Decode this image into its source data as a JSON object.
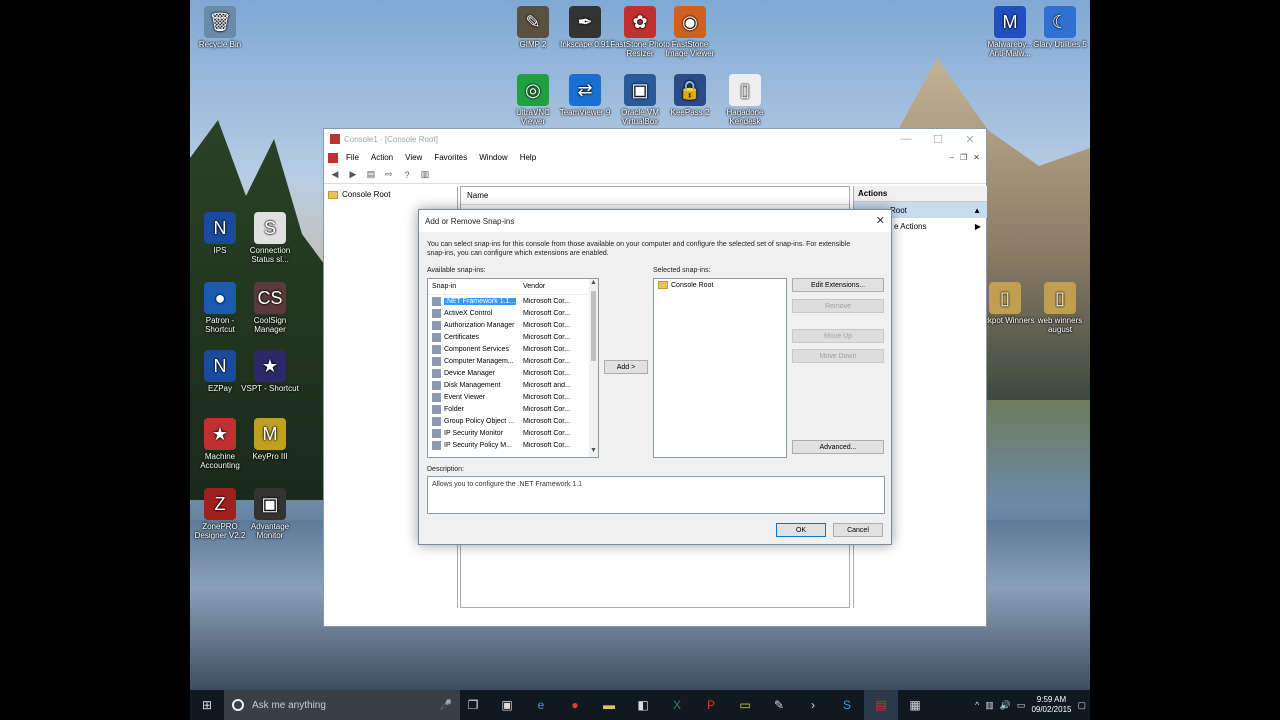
{
  "desktop": {
    "icons": [
      {
        "label": "Recycle Bin",
        "glyph": "🗑",
        "color": "#6a8aa8"
      },
      {
        "label": "GIMP 2",
        "glyph": "✎",
        "color": "#5a5040"
      },
      {
        "label": "Inkscape 0.91",
        "glyph": "✒",
        "color": "#333"
      },
      {
        "label": "FastStone Photo Resizer",
        "glyph": "✿",
        "color": "#c03030"
      },
      {
        "label": "FastStone Image Viewer",
        "glyph": "◉",
        "color": "#d06020"
      },
      {
        "label": "Malwareby... Anti-Malw...",
        "glyph": "M",
        "color": "#2050c0"
      },
      {
        "label": "Glary Utilities 5",
        "glyph": "☾",
        "color": "#3070d0"
      },
      {
        "label": "UltraVNC Viewer",
        "glyph": "◎",
        "color": "#20a040"
      },
      {
        "label": "TeamViewer 9",
        "glyph": "⇄",
        "color": "#1a70d0"
      },
      {
        "label": "Oracle VM VirtualBox",
        "glyph": "▣",
        "color": "#2a5a9a"
      },
      {
        "label": "KeePass 2",
        "glyph": "🔒",
        "color": "#2a4a8a"
      },
      {
        "label": "Hagadone Kendesk",
        "glyph": "▯",
        "color": "#eee"
      },
      {
        "label": "IPS",
        "glyph": "N",
        "color": "#1a4a9a"
      },
      {
        "label": "Connection Status sl...",
        "glyph": "S",
        "color": "#e0e0e0"
      },
      {
        "label": "Patron - Shortcut",
        "glyph": "●",
        "color": "#1a5ab0"
      },
      {
        "label": "CoolSign Manager",
        "glyph": "CS",
        "color": "#5a3a3a"
      },
      {
        "label": "EZPay",
        "glyph": "N",
        "color": "#1a4a9a"
      },
      {
        "label": "VSPT - Shortcut",
        "glyph": "★",
        "color": "#2a2a6a"
      },
      {
        "label": "Machine Accounting",
        "glyph": "★",
        "color": "#c03030"
      },
      {
        "label": "KeyPro III",
        "glyph": "M",
        "color": "#c0a020"
      },
      {
        "label": "ZonePRO Designer V2.2",
        "glyph": "Z",
        "color": "#a02020"
      },
      {
        "label": "Advantage Monitor",
        "glyph": "▣",
        "color": "#333"
      },
      {
        "label": "Jackpot Winners",
        "glyph": "▯",
        "color": "#c0a050"
      },
      {
        "label": "web winners august",
        "glyph": "▯",
        "color": "#c0a050"
      }
    ]
  },
  "mmc": {
    "title": "Console1 - [Console Root]",
    "menu": [
      "File",
      "Action",
      "View",
      "Favorites",
      "Window",
      "Help"
    ],
    "tree_root": "Console Root",
    "column_name": "Name",
    "actions_header": "Actions",
    "actions_selected": "Root",
    "actions_more": "e Actions"
  },
  "dialog": {
    "title": "Add or Remove Snap-ins",
    "intro": "You can select snap-ins for this console from those available on your computer and configure the selected set of snap-ins. For extensible snap-ins, you can configure which extensions are enabled.",
    "available_label": "Available snap-ins:",
    "selected_label": "Selected snap-ins:",
    "col_snapin": "Snap-in",
    "col_vendor": "Vendor",
    "snapins": [
      {
        "name": ".NET Framework 1.1...",
        "vendor": "Microsoft Cor..."
      },
      {
        "name": "ActiveX Control",
        "vendor": "Microsoft Cor..."
      },
      {
        "name": "Authorization Manager",
        "vendor": "Microsoft Cor..."
      },
      {
        "name": "Certificates",
        "vendor": "Microsoft Cor..."
      },
      {
        "name": "Component Services",
        "vendor": "Microsoft Cor..."
      },
      {
        "name": "Computer Managem...",
        "vendor": "Microsoft Cor..."
      },
      {
        "name": "Device Manager",
        "vendor": "Microsoft Cor..."
      },
      {
        "name": "Disk Management",
        "vendor": "Microsoft and..."
      },
      {
        "name": "Event Viewer",
        "vendor": "Microsoft Cor..."
      },
      {
        "name": "Folder",
        "vendor": "Microsoft Cor..."
      },
      {
        "name": "Group Policy Object ...",
        "vendor": "Microsoft Cor..."
      },
      {
        "name": "IP Security Monitor",
        "vendor": "Microsoft Cor..."
      },
      {
        "name": "IP Security Policy M...",
        "vendor": "Microsoft Cor..."
      }
    ],
    "selected_root": "Console Root",
    "add_label": "Add >",
    "edit_ext_label": "Edit Extensions...",
    "remove_label": "Remove",
    "move_up_label": "Move Up",
    "move_down_label": "Move Down",
    "advanced_label": "Advanced...",
    "description_label": "Description:",
    "description_text": "Allows you to configure the .NET Framework 1.1",
    "ok_label": "OK",
    "cancel_label": "Cancel"
  },
  "taskbar": {
    "search_placeholder": "Ask me anything",
    "time": "9:59 AM",
    "date": "09/02/2015"
  }
}
